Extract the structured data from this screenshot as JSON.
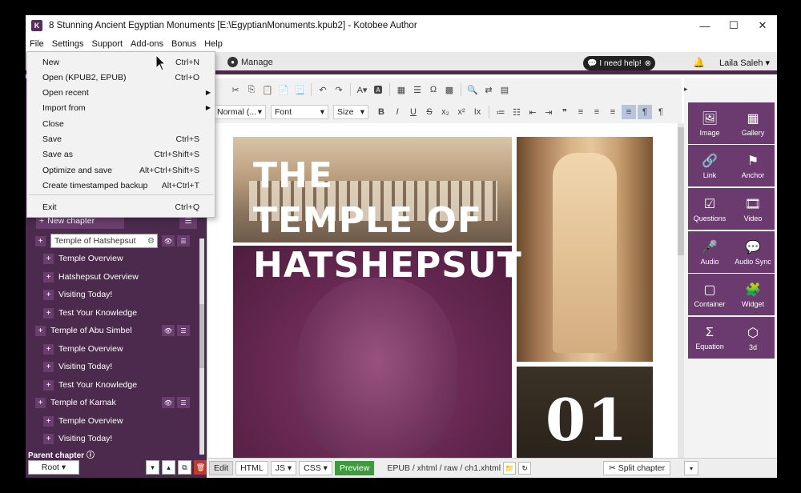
{
  "titlebar": {
    "title": "8 Stunning Ancient Egyptian Monuments [E:\\EgyptianMonuments.kpub2] - Kotobee Author",
    "minimize": "—",
    "maximize": "☐",
    "close": "✕"
  },
  "menubar": [
    "File",
    "Settings",
    "Support",
    "Add-ons",
    "Bonus",
    "Help"
  ],
  "topbar": {
    "manage": "Manage",
    "help": "I need help!",
    "user": "Laila Saleh"
  },
  "file_menu": [
    {
      "label": "New",
      "shortcut": "Ctrl+N"
    },
    {
      "label": "Open (KPUB2, EPUB)",
      "shortcut": "Ctrl+O"
    },
    {
      "label": "Open recent",
      "shortcut": "",
      "submenu": true
    },
    {
      "label": "Import from",
      "shortcut": "",
      "submenu": true
    },
    {
      "label": "Close",
      "shortcut": ""
    },
    {
      "label": "Save",
      "shortcut": "Ctrl+S"
    },
    {
      "label": "Save as",
      "shortcut": "Ctrl+Shift+S"
    },
    {
      "label": "Optimize and save",
      "shortcut": "Alt+Ctrl+Shift+S"
    },
    {
      "label": "Create timestamped backup",
      "shortcut": "Alt+Ctrl+T"
    },
    {
      "label": "Exit",
      "shortcut": "Ctrl+Q"
    }
  ],
  "sidebar": {
    "new_chapter": "New chapter",
    "chapters": [
      {
        "label": "Temple of Hatshepsut",
        "level": 0,
        "editing": true
      },
      {
        "label": "Temple Overview",
        "level": 1
      },
      {
        "label": "Hatshepsut Overview",
        "level": 1
      },
      {
        "label": "Visiting Today!",
        "level": 1
      },
      {
        "label": "Test Your Knowledge",
        "level": 1
      },
      {
        "label": "Temple of Abu Simbel",
        "level": 0
      },
      {
        "label": "Temple Overview",
        "level": 1
      },
      {
        "label": "Visiting Today!",
        "level": 1
      },
      {
        "label": "Test Your Knowledge",
        "level": 1
      },
      {
        "label": "Temple of Karnak",
        "level": 0
      },
      {
        "label": "Temple Overview",
        "level": 1
      },
      {
        "label": "Visiting Today!",
        "level": 1
      }
    ],
    "parent_chapter": "Parent chapter",
    "root": "Root"
  },
  "toolbar": {
    "format": "Normal (...",
    "font": "Font",
    "size": "Size"
  },
  "page": {
    "headline_lines": [
      "THE",
      "TEMPLE OF",
      "HATSHEPSUT"
    ],
    "chapter_number": "01"
  },
  "bottombar": {
    "edit": "Edit",
    "html": "HTML",
    "js": "JS",
    "css": "CSS",
    "preview": "Preview",
    "path": "EPUB / xhtml / raw / ch1.xhtml",
    "split": "Split chapter"
  },
  "widgets": [
    {
      "label": "Image",
      "icon": "🖼"
    },
    {
      "label": "Gallery",
      "icon": "▦"
    },
    {
      "label": "Link",
      "icon": "🔗"
    },
    {
      "label": "Anchor",
      "icon": "⚑"
    },
    {
      "label": "Questions",
      "icon": "☑"
    },
    {
      "label": "Video",
      "icon": "🎞"
    },
    {
      "label": "Audio",
      "icon": "🎤"
    },
    {
      "label": "Audio Sync",
      "icon": "💬"
    },
    {
      "label": "Container",
      "icon": "▢"
    },
    {
      "label": "Widget",
      "icon": "🧩"
    },
    {
      "label": "Equation",
      "icon": "Σ"
    },
    {
      "label": "3d",
      "icon": "⬡"
    }
  ],
  "colors": {
    "purple": "#4b2a4d",
    "widget": "#6b3a6e",
    "preview": "#3f9a3f"
  }
}
